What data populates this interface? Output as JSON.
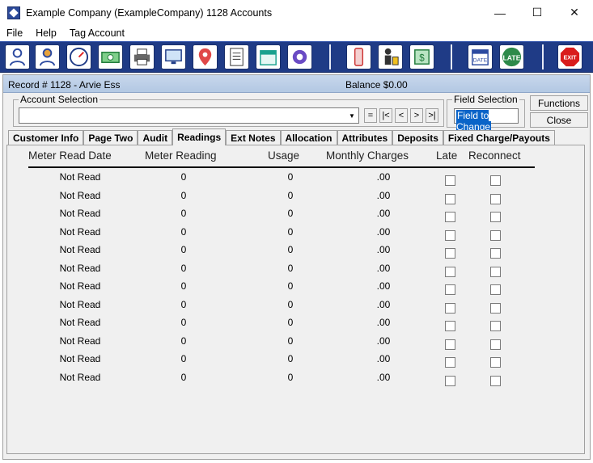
{
  "window": {
    "title": "Example Company (ExampleCompany)  1128 Accounts"
  },
  "window_controls": {
    "minimize": "—",
    "maximize": "☐",
    "close": "✕"
  },
  "menu": [
    "File",
    "Help",
    "Tag Account"
  ],
  "toolbar": {
    "icons": [
      "customer-icon",
      "account-icon",
      "gauge-icon",
      "cash-icon",
      "printer-icon",
      "monitor-icon",
      "map-pin-icon",
      "document-icon",
      "calendar-icon",
      "gear-icon",
      "phone-icon",
      "worker-icon",
      "bill-icon",
      "date-icon",
      "late-icon",
      "exit-icon"
    ],
    "date_text": "DATE",
    "late_text": "LATE",
    "exit_text": "EXIT"
  },
  "record": {
    "label": "Record # 1128 - Arvie Ess",
    "balance": "Balance  $0.00"
  },
  "account_selection": {
    "legend": "Account Selection",
    "value": "",
    "nav": [
      "=",
      "|<",
      "<",
      ">",
      ">|"
    ]
  },
  "field_selection": {
    "legend": "Field Selection",
    "value": "Field to Change"
  },
  "buttons": {
    "functions": "Functions",
    "close": "Close"
  },
  "tabs": [
    "Customer Info",
    "Page Two",
    "Audit",
    "Readings",
    "Ext Notes",
    "Allocation",
    "Attributes",
    "Deposits",
    "Fixed Charge/Payouts"
  ],
  "active_tab": "Readings",
  "readings": {
    "columns": [
      "Meter Read Date",
      "Meter Reading",
      "Usage",
      "Monthly Charges",
      "Late",
      "Reconnect"
    ],
    "rows": [
      {
        "date": "Not Read",
        "reading": "0",
        "usage": "0",
        "charges": ".00",
        "late": false,
        "reconnect": false
      },
      {
        "date": "Not Read",
        "reading": "0",
        "usage": "0",
        "charges": ".00",
        "late": false,
        "reconnect": false
      },
      {
        "date": "Not Read",
        "reading": "0",
        "usage": "0",
        "charges": ".00",
        "late": false,
        "reconnect": false
      },
      {
        "date": "Not Read",
        "reading": "0",
        "usage": "0",
        "charges": ".00",
        "late": false,
        "reconnect": false
      },
      {
        "date": "Not Read",
        "reading": "0",
        "usage": "0",
        "charges": ".00",
        "late": false,
        "reconnect": false
      },
      {
        "date": "Not Read",
        "reading": "0",
        "usage": "0",
        "charges": ".00",
        "late": false,
        "reconnect": false
      },
      {
        "date": "Not Read",
        "reading": "0",
        "usage": "0",
        "charges": ".00",
        "late": false,
        "reconnect": false
      },
      {
        "date": "Not Read",
        "reading": "0",
        "usage": "0",
        "charges": ".00",
        "late": false,
        "reconnect": false
      },
      {
        "date": "Not Read",
        "reading": "0",
        "usage": "0",
        "charges": ".00",
        "late": false,
        "reconnect": false
      },
      {
        "date": "Not Read",
        "reading": "0",
        "usage": "0",
        "charges": ".00",
        "late": false,
        "reconnect": false
      },
      {
        "date": "Not Read",
        "reading": "0",
        "usage": "0",
        "charges": ".00",
        "late": false,
        "reconnect": false
      },
      {
        "date": "Not Read",
        "reading": "0",
        "usage": "0",
        "charges": ".00",
        "late": false,
        "reconnect": false
      }
    ]
  }
}
